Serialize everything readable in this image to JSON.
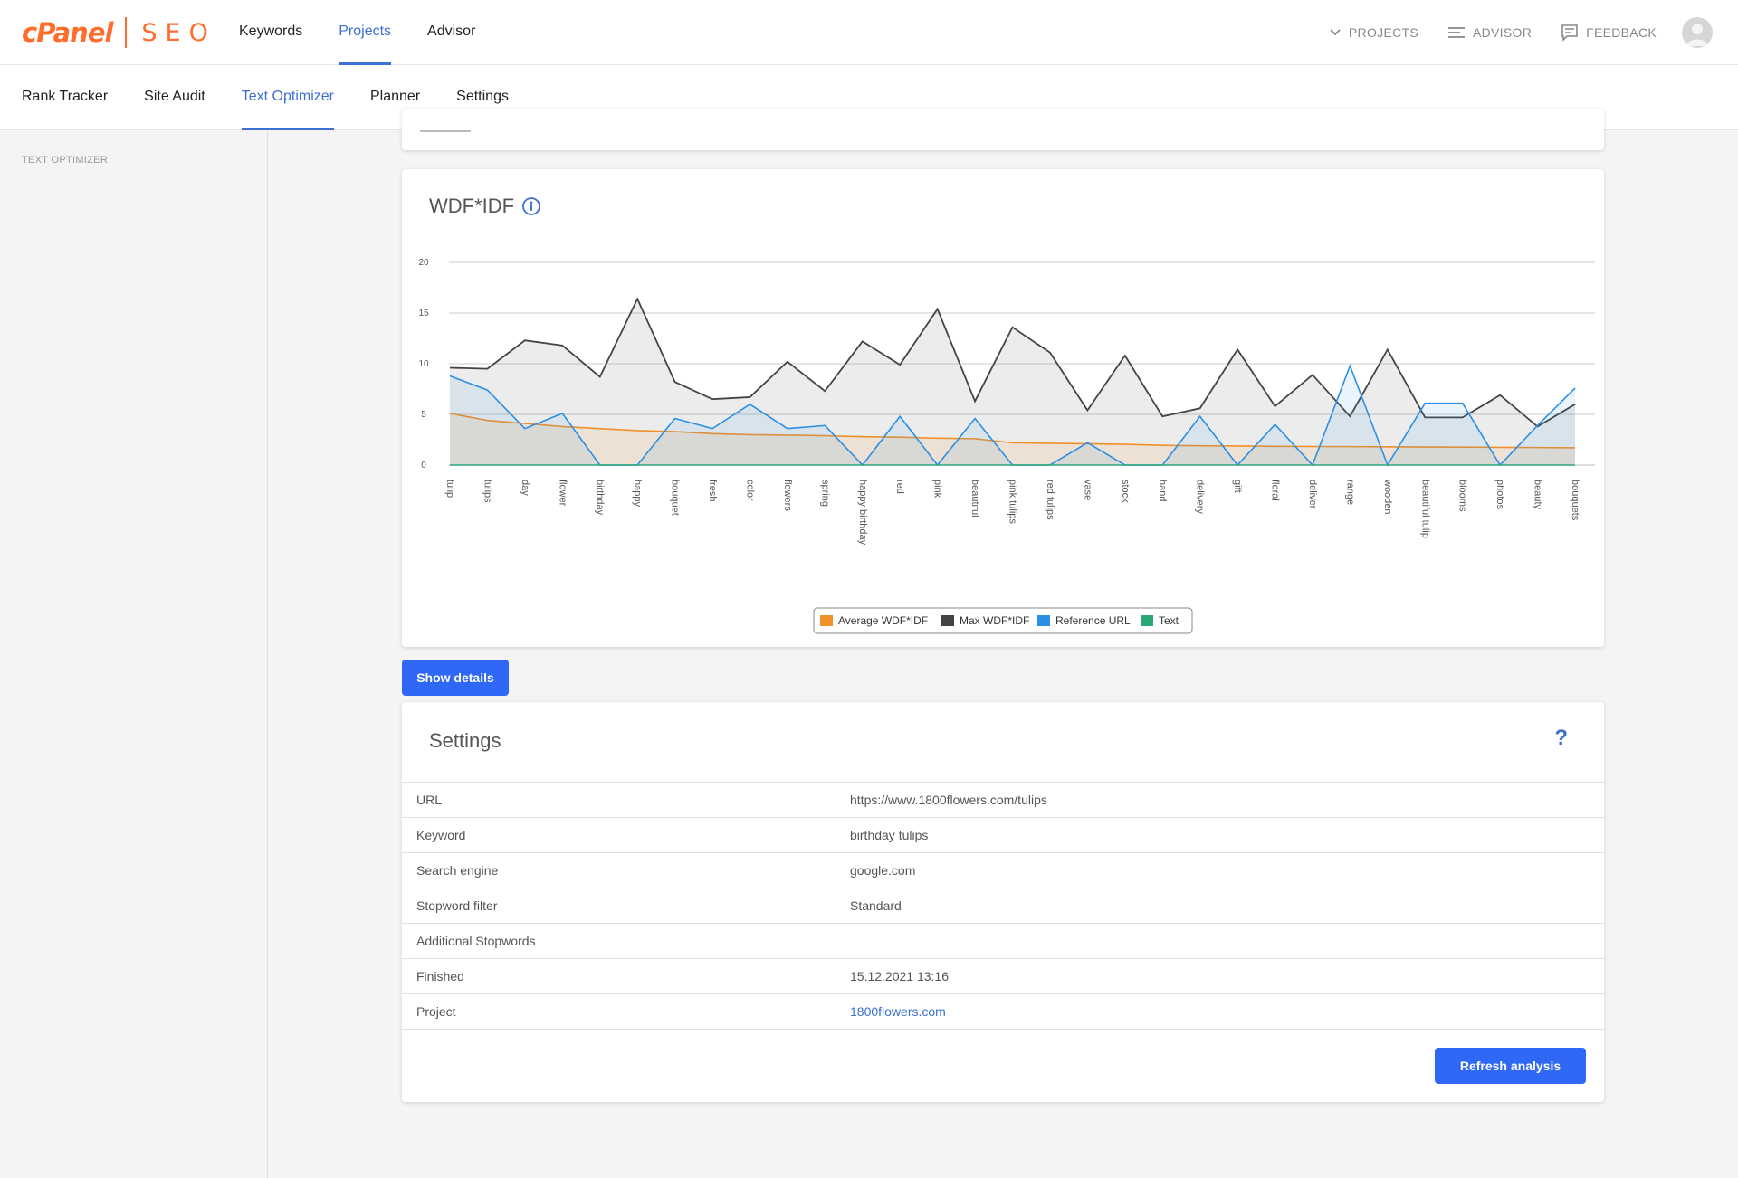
{
  "brand": {
    "name": "cPanel",
    "product": "SEO"
  },
  "main_nav": [
    {
      "label": "Keywords",
      "active": false
    },
    {
      "label": "Projects",
      "active": true
    },
    {
      "label": "Advisor",
      "active": false
    }
  ],
  "top_right": {
    "projects": "PROJECTS",
    "advisor": "ADVISOR",
    "feedback": "FEEDBACK"
  },
  "sub_nav": [
    {
      "label": "Rank Tracker",
      "active": false
    },
    {
      "label": "Site Audit",
      "active": false
    },
    {
      "label": "Text Optimizer",
      "active": true
    },
    {
      "label": "Planner",
      "active": false
    },
    {
      "label": "Settings",
      "active": false
    }
  ],
  "sidebar": {
    "title": "TEXT OPTIMIZER"
  },
  "wdf_card": {
    "title": "WDF*IDF"
  },
  "show_details_label": "Show details",
  "settings": {
    "title": "Settings",
    "help": "?",
    "rows": [
      {
        "key": "URL",
        "value": "https://www.1800flowers.com/tulips",
        "link": false
      },
      {
        "key": "Keyword",
        "value": "birthday tulips",
        "link": false
      },
      {
        "key": "Search engine",
        "value": "google.com",
        "link": false
      },
      {
        "key": "Stopword filter",
        "value": "Standard",
        "link": false
      },
      {
        "key": "Additional Stopwords",
        "value": "",
        "link": false
      },
      {
        "key": "Finished",
        "value": "15.12.2021 13:16",
        "link": false
      },
      {
        "key": "Project",
        "value": "1800flowers.com",
        "link": true
      }
    ],
    "refresh_label": "Refresh analysis"
  },
  "colors": {
    "accent": "#3d6fd4",
    "button": "#2f68f5",
    "brand": "#ff6c2c",
    "average": "#f0902a",
    "max": "#444444",
    "reference": "#2b8fe6",
    "text": "#2aa876"
  },
  "chart_data": {
    "type": "area",
    "ylim": [
      0,
      20
    ],
    "yticks": [
      0,
      5,
      10,
      15,
      20
    ],
    "grid": true,
    "legend_position": "bottom-center",
    "categories": [
      "tulip",
      "tulips",
      "day",
      "flower",
      "birthday",
      "happy",
      "bouquet",
      "fresh",
      "color",
      "flowers",
      "spring",
      "happy birthday",
      "red",
      "pink",
      "beautiful",
      "pink tulips",
      "red tulips",
      "vase",
      "stock",
      "hand",
      "delivery",
      "gift",
      "floral",
      "deliver",
      "range",
      "wooden",
      "beautiful tulip",
      "blooms",
      "photos",
      "beauty",
      "bouquets"
    ],
    "series": [
      {
        "name": "Average WDF*IDF",
        "color": "#f0902a",
        "values": [
          5.1,
          4.4,
          4.1,
          3.8,
          3.6,
          3.4,
          3.3,
          3.1,
          3.0,
          2.95,
          2.9,
          2.8,
          2.75,
          2.65,
          2.6,
          2.2,
          2.15,
          2.1,
          2.05,
          1.95,
          1.9,
          1.88,
          1.85,
          1.83,
          1.82,
          1.8,
          1.78,
          1.77,
          1.75,
          1.73,
          1.7
        ]
      },
      {
        "name": "Max WDF*IDF",
        "color": "#444444",
        "values": [
          9.6,
          9.5,
          12.3,
          11.8,
          8.7,
          16.4,
          8.2,
          6.5,
          6.7,
          10.2,
          7.3,
          12.2,
          9.9,
          15.4,
          6.3,
          13.6,
          11.1,
          5.4,
          10.8,
          4.8,
          5.6,
          11.4,
          5.8,
          8.9,
          4.8,
          11.4,
          4.7,
          4.7,
          6.9,
          3.8,
          6.0
        ]
      },
      {
        "name": "Reference URL",
        "color": "#2b8fe6",
        "values": [
          8.8,
          7.4,
          3.6,
          5.1,
          0,
          0,
          4.6,
          3.6,
          6.0,
          3.6,
          3.9,
          0,
          4.8,
          0,
          4.6,
          0,
          0,
          2.2,
          0,
          0,
          4.8,
          0,
          4.0,
          0,
          9.8,
          0,
          6.1,
          6.1,
          0,
          3.9,
          7.6
        ]
      },
      {
        "name": "Text",
        "color": "#2aa876",
        "values": [
          0,
          0,
          0,
          0,
          0,
          0,
          0,
          0,
          0,
          0,
          0,
          0,
          0,
          0,
          0,
          0,
          0,
          0,
          0,
          0,
          0,
          0,
          0,
          0,
          0,
          0,
          0,
          0,
          0,
          0,
          0
        ]
      }
    ]
  }
}
